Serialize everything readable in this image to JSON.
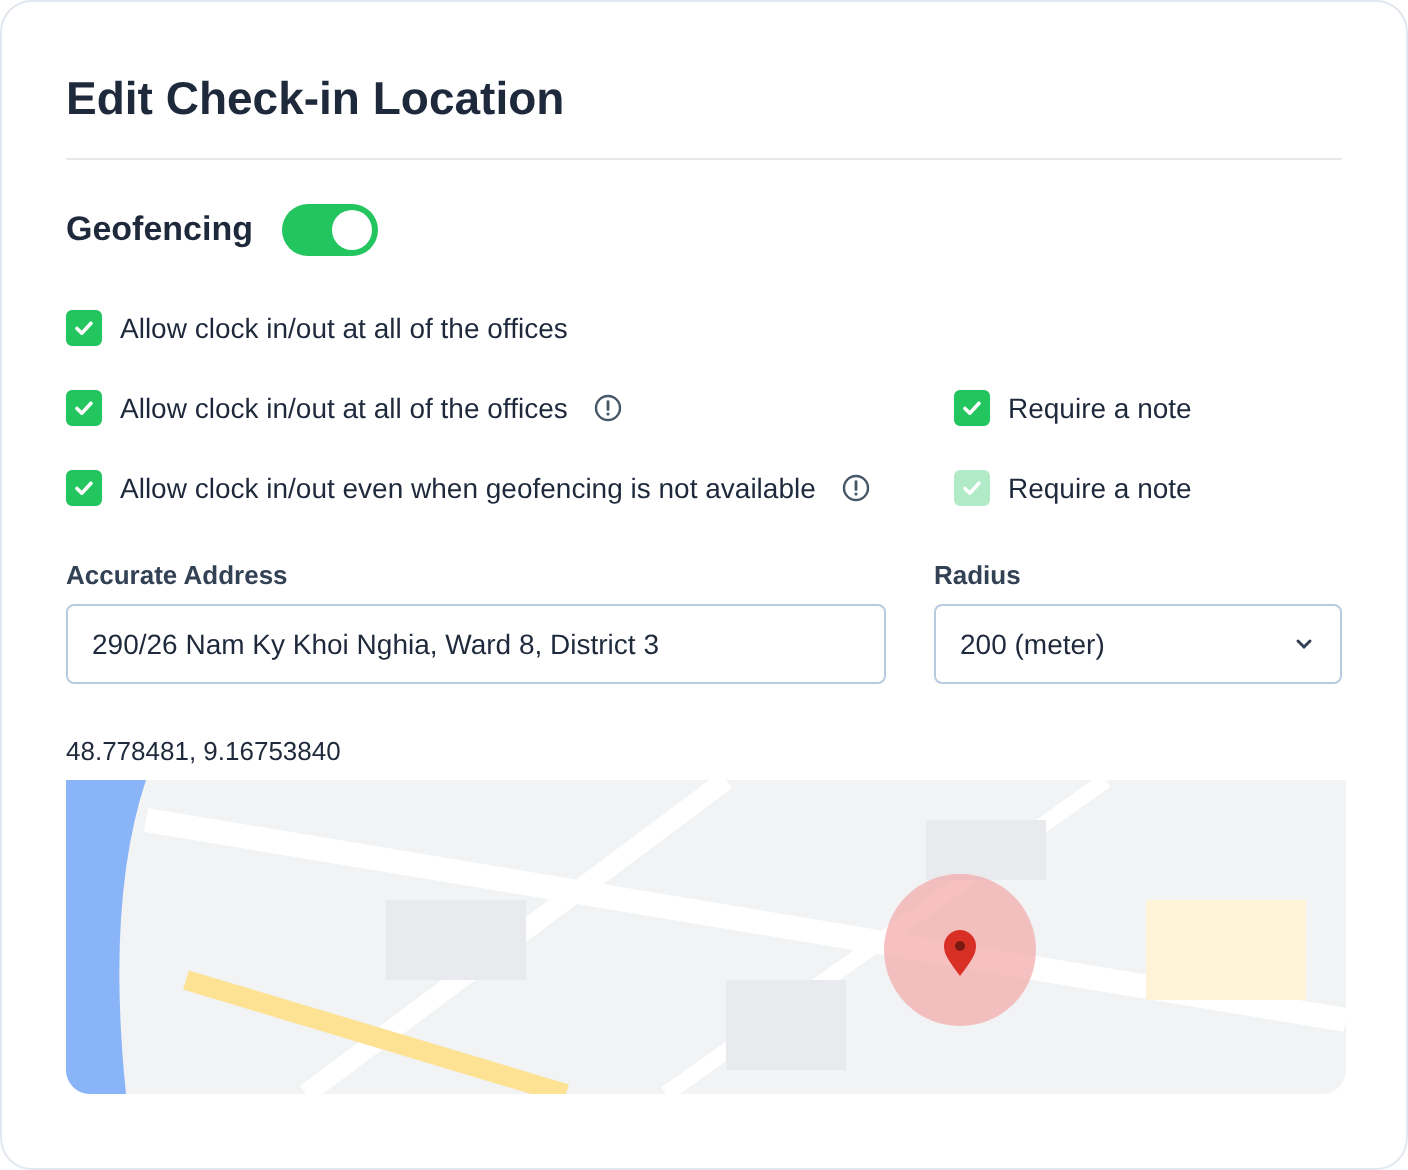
{
  "title": "Edit Check-in Location",
  "geofencing": {
    "label": "Geofencing",
    "on": true
  },
  "options": [
    {
      "label": "Allow clock in/out at all of the offices",
      "checked": true,
      "info": false
    },
    {
      "label": "Allow clock in/out at all of the offices",
      "checked": true,
      "info": true,
      "note": {
        "label": "Require a note",
        "checked": true,
        "disabled": false
      }
    },
    {
      "label": "Allow clock in/out even when geofencing is not available",
      "checked": true,
      "info": true,
      "note": {
        "label": "Require a note",
        "checked": true,
        "disabled": true
      }
    }
  ],
  "address": {
    "label": "Accurate Address",
    "value": "290/26 Nam Ky Khoi Nghia, Ward 8, District 3"
  },
  "radius": {
    "label": "Radius",
    "value": "200 (meter)"
  },
  "coordinates": "48.778481, 9.16753840"
}
